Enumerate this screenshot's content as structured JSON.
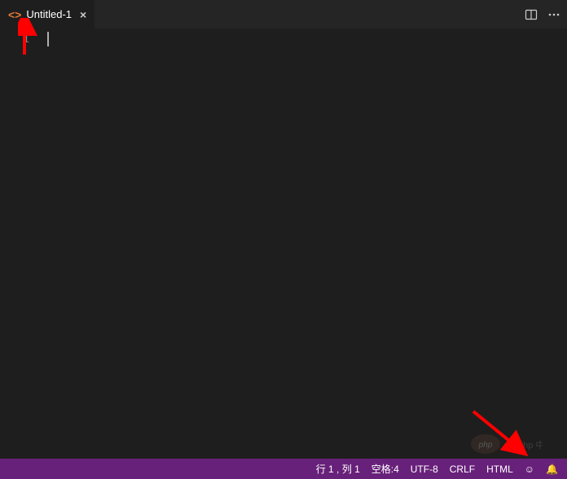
{
  "tab": {
    "label": "Untitled-1",
    "iconGlyph": "<>"
  },
  "gutter": {
    "line1": "1"
  },
  "statusBar": {
    "position": "行 1 , 列 1",
    "indent": "空格:4",
    "encoding": "UTF-8",
    "eol": "CRLF",
    "language": "HTML",
    "smile": "☺",
    "bell": "🔔"
  },
  "watermark": {
    "text": "php 中文网"
  }
}
